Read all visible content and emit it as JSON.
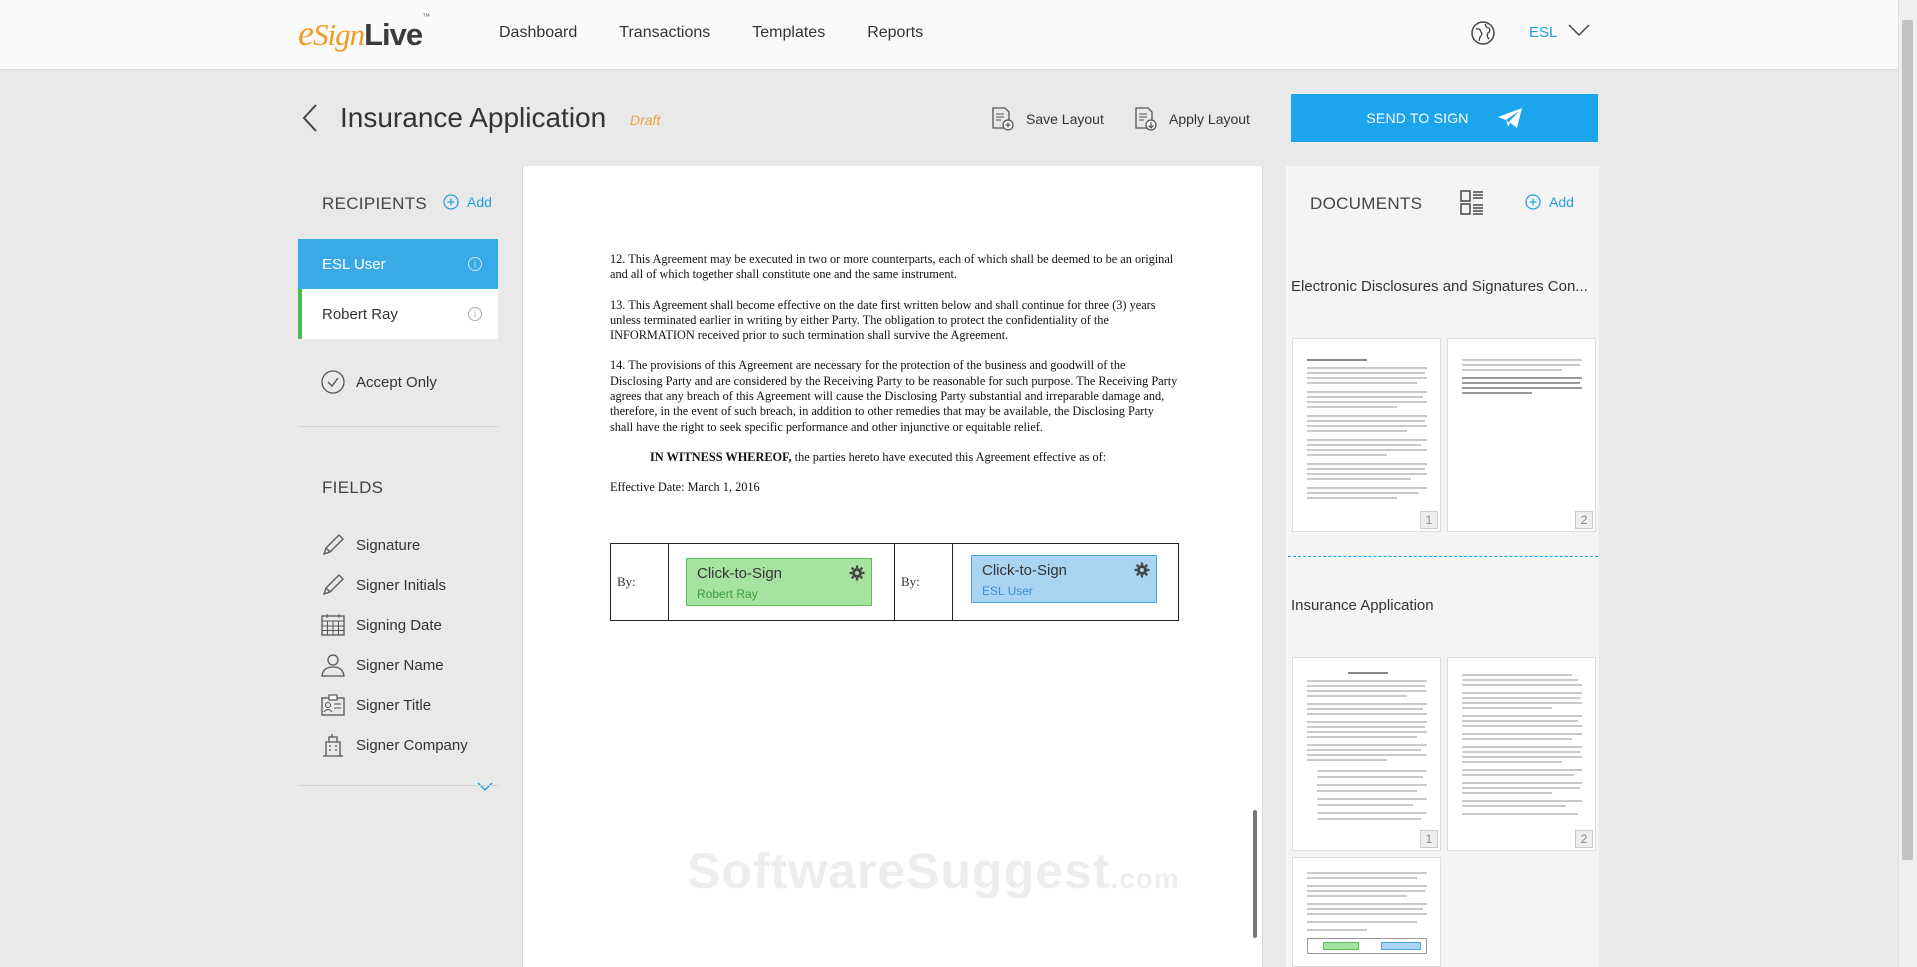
{
  "app": {
    "logo_prefix": "e",
    "logo_sign": "Sign",
    "logo_live": "Live",
    "logo_tm": "™"
  },
  "nav": {
    "items": [
      "Dashboard",
      "Transactions",
      "Templates",
      "Reports"
    ],
    "language": "ESL"
  },
  "header": {
    "title": "Insurance Application",
    "status": "Draft",
    "save_layout": "Save Layout",
    "apply_layout": "Apply Layout",
    "send_to_sign": "SEND TO SIGN"
  },
  "recipients": {
    "title": "RECIPIENTS",
    "add_label": "Add",
    "items": [
      {
        "name": "ESL User",
        "color": "#3aa9e8"
      },
      {
        "name": "Robert Ray",
        "color": "#4dbb4d"
      }
    ],
    "accept_only": "Accept Only"
  },
  "fields": {
    "title": "FIELDS",
    "items": [
      "Signature",
      "Signer Initials",
      "Signing Date",
      "Signer Name",
      "Signer Title",
      "Signer Company"
    ]
  },
  "document": {
    "paragraphs": [
      "12.        This Agreement may be executed in two or more counterparts, each of which shall be deemed to be an original and all of which together shall constitute one and the same instrument.",
      "13.        This Agreement shall become effective on the date first written below and shall continue for three (3) years unless terminated earlier in writing by either Party. The obligation to protect the confidentiality of the INFORMATION received prior to such termination shall survive the Agreement.",
      "14.        The provisions of this Agreement are necessary for the protection of the business and goodwill of the Disclosing Party and are considered by the Receiving Party to be reasonable for such purpose. The Receiving Party agrees that any breach of this Agreement will cause the Disclosing Party substantial and irreparable damage and, therefore, in the event of such breach, in addition to other remedies that may be available, the Disclosing Party shall have the right to seek specific performance and other injunctive or equitable relief."
    ],
    "witness_bold": "IN WITNESS WHEREOF,",
    "witness_rest": " the parties hereto have executed this Agreement effective as of:",
    "effective_date": "Effective Date: March 1, 2016",
    "by_label": "By:",
    "sig_boxes": [
      {
        "label": "Click-to-Sign",
        "signer": "Robert Ray",
        "bg": "#a6e3a0",
        "border": "#5cc05a",
        "text": "#3d9a3d"
      },
      {
        "label": "Click-to-Sign",
        "signer": "ESL User",
        "bg": "#a9d4f2",
        "border": "#4aa4e0",
        "text": "#3a8fd0"
      }
    ],
    "watermark": "SoftwareSuggest",
    "watermark_suffix": ".com"
  },
  "documents": {
    "title": "DOCUMENTS",
    "add_label": "Add",
    "groups": [
      {
        "name": "Electronic Disclosures and Signatures Con...",
        "pages": [
          "1",
          "2"
        ]
      },
      {
        "name": "Insurance Application",
        "pages": [
          "1",
          "2"
        ]
      }
    ]
  },
  "colors": {
    "accent": "#1aa5ec",
    "draft": "#f0a040",
    "logo_orange": "#f29a1f"
  }
}
